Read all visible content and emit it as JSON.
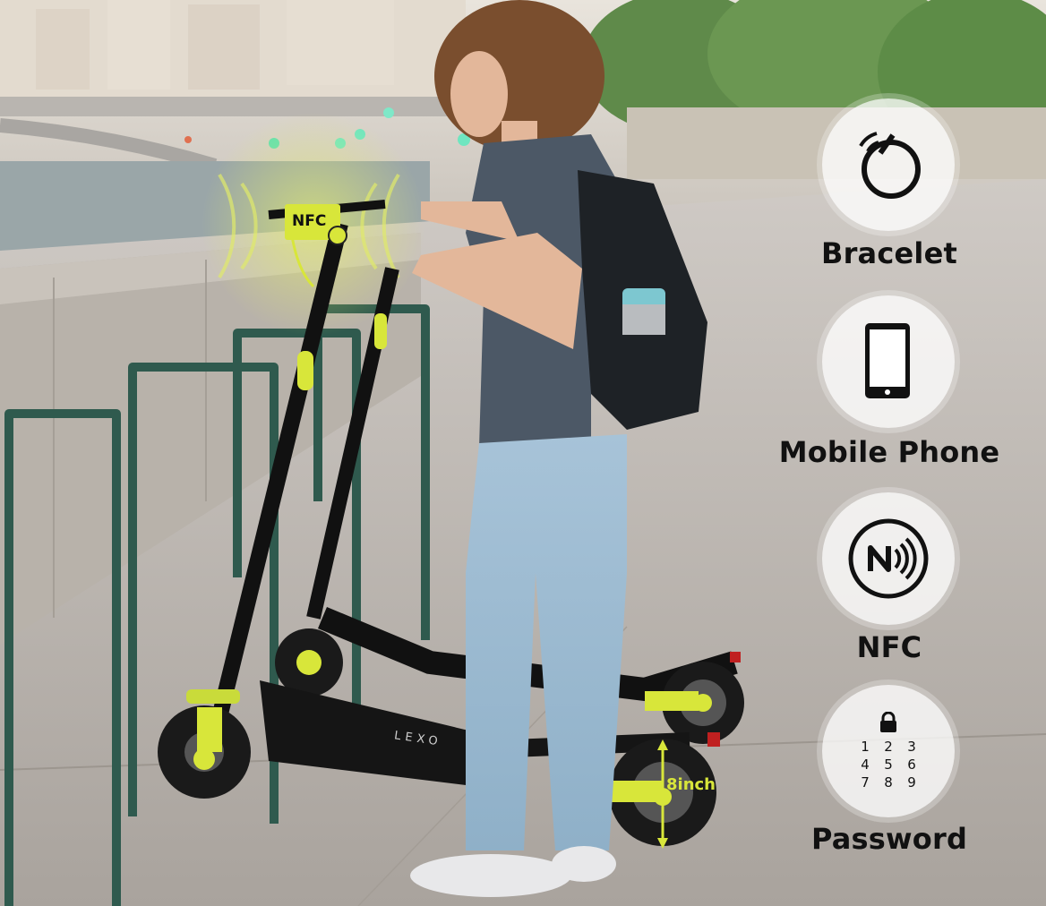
{
  "features": [
    {
      "icon": "bracelet-icon",
      "label": "Bracelet"
    },
    {
      "icon": "mobile-phone-icon",
      "label": "Mobile Phone"
    },
    {
      "icon": "nfc-icon",
      "label": "NFC"
    },
    {
      "icon": "keypad-lock-icon",
      "label": "Password"
    }
  ],
  "keypad_digits": [
    "1",
    "2",
    "3",
    "4",
    "5",
    "6",
    "7",
    "8",
    "9"
  ],
  "scooter": {
    "nfc_tag_text": "NFC",
    "wheel_size_label": "8inch",
    "deck_brand": "LEXO"
  },
  "colors": {
    "accent": "#d8e63a",
    "label_text": "#111111",
    "badge_bg": "#ffffff"
  }
}
